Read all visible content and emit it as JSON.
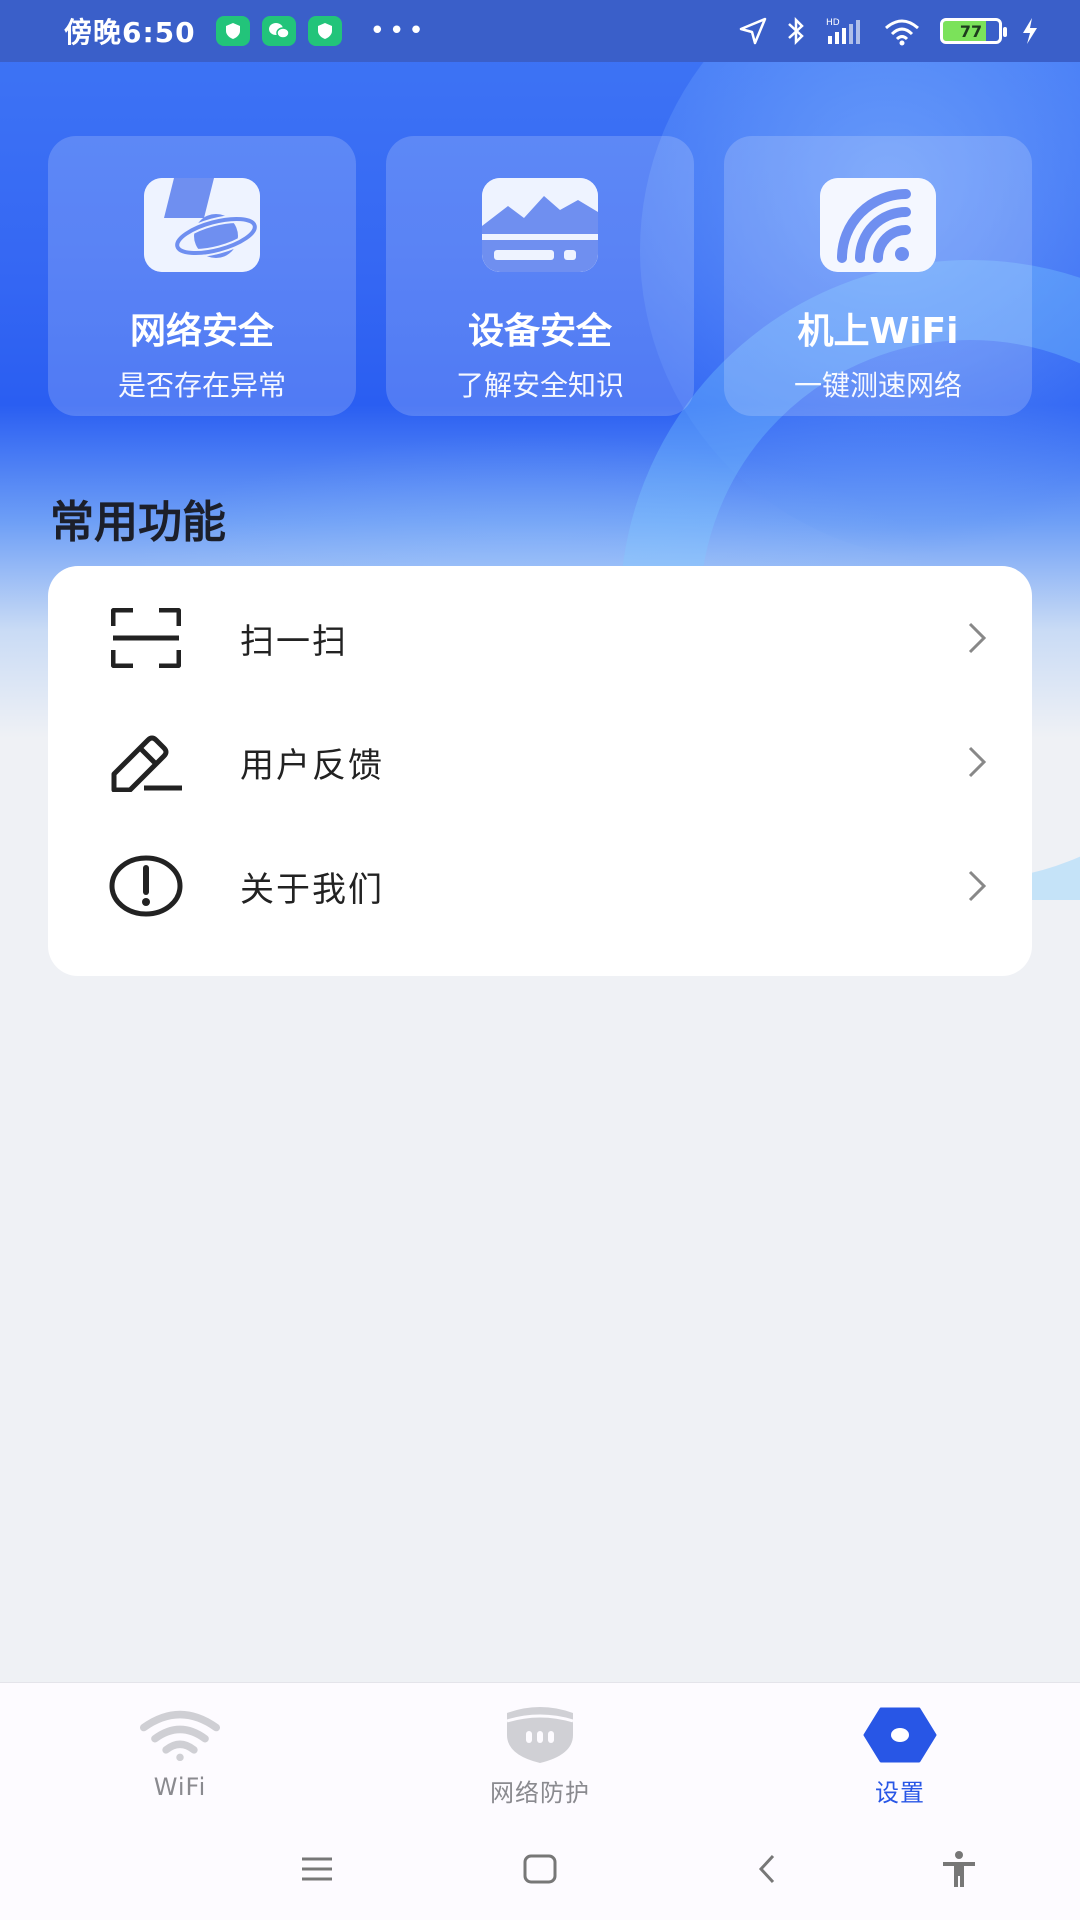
{
  "status_bar": {
    "time": "傍晚6:50",
    "more": "•••",
    "battery": "77"
  },
  "quick_cards": [
    {
      "title": "网络安全",
      "subtitle": "是否存在异常",
      "icon": "planet-icon"
    },
    {
      "title": "设备安全",
      "subtitle": "了解安全知识",
      "icon": "device-chart-icon"
    },
    {
      "title": "机上WiFi",
      "subtitle": "一键测速网络",
      "icon": "wifi-signal-icon"
    }
  ],
  "section": {
    "title": "常用功能"
  },
  "functions": [
    {
      "label": "扫一扫",
      "icon": "scan-icon"
    },
    {
      "label": "用户反馈",
      "icon": "edit-pen-icon"
    },
    {
      "label": "关于我们",
      "icon": "info-alert-icon"
    }
  ],
  "bottom_nav": [
    {
      "label": "WiFi",
      "icon": "wifi-icon",
      "active": false
    },
    {
      "label": "网络防护",
      "icon": "shield-icon",
      "active": false
    },
    {
      "label": "设置",
      "icon": "settings-hex-icon",
      "active": true
    }
  ],
  "colors": {
    "accent": "#2856e6",
    "hero": "#3567f3",
    "background": "#eff1f5"
  }
}
